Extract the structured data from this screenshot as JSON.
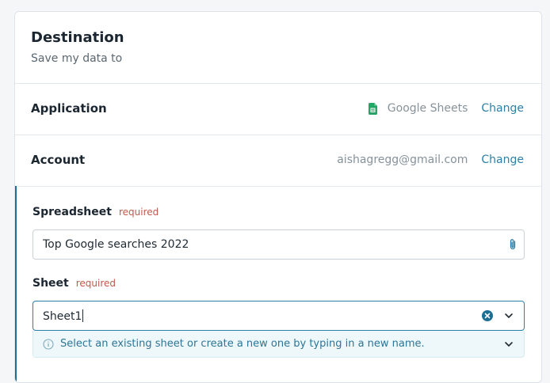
{
  "header": {
    "title": "Destination",
    "subtitle": "Save my data to"
  },
  "application": {
    "label": "Application",
    "value": "Google Sheets",
    "icon": "google-sheets-icon",
    "change_label": "Change"
  },
  "account": {
    "label": "Account",
    "value": "aishagregg@gmail.com",
    "change_label": "Change"
  },
  "spreadsheet": {
    "label": "Spreadsheet",
    "required_label": "required",
    "value": "Top Google searches 2022",
    "icon": "paperclip-icon"
  },
  "sheet": {
    "label": "Sheet",
    "required_label": "required",
    "value": "Sheet1",
    "hint": "Select an existing sheet or create a new one by typing in a new name."
  },
  "colors": {
    "accent": "#1b6f95",
    "link": "#2f7fa6",
    "required": "#c0584c",
    "sheets_green": "#23a566"
  }
}
